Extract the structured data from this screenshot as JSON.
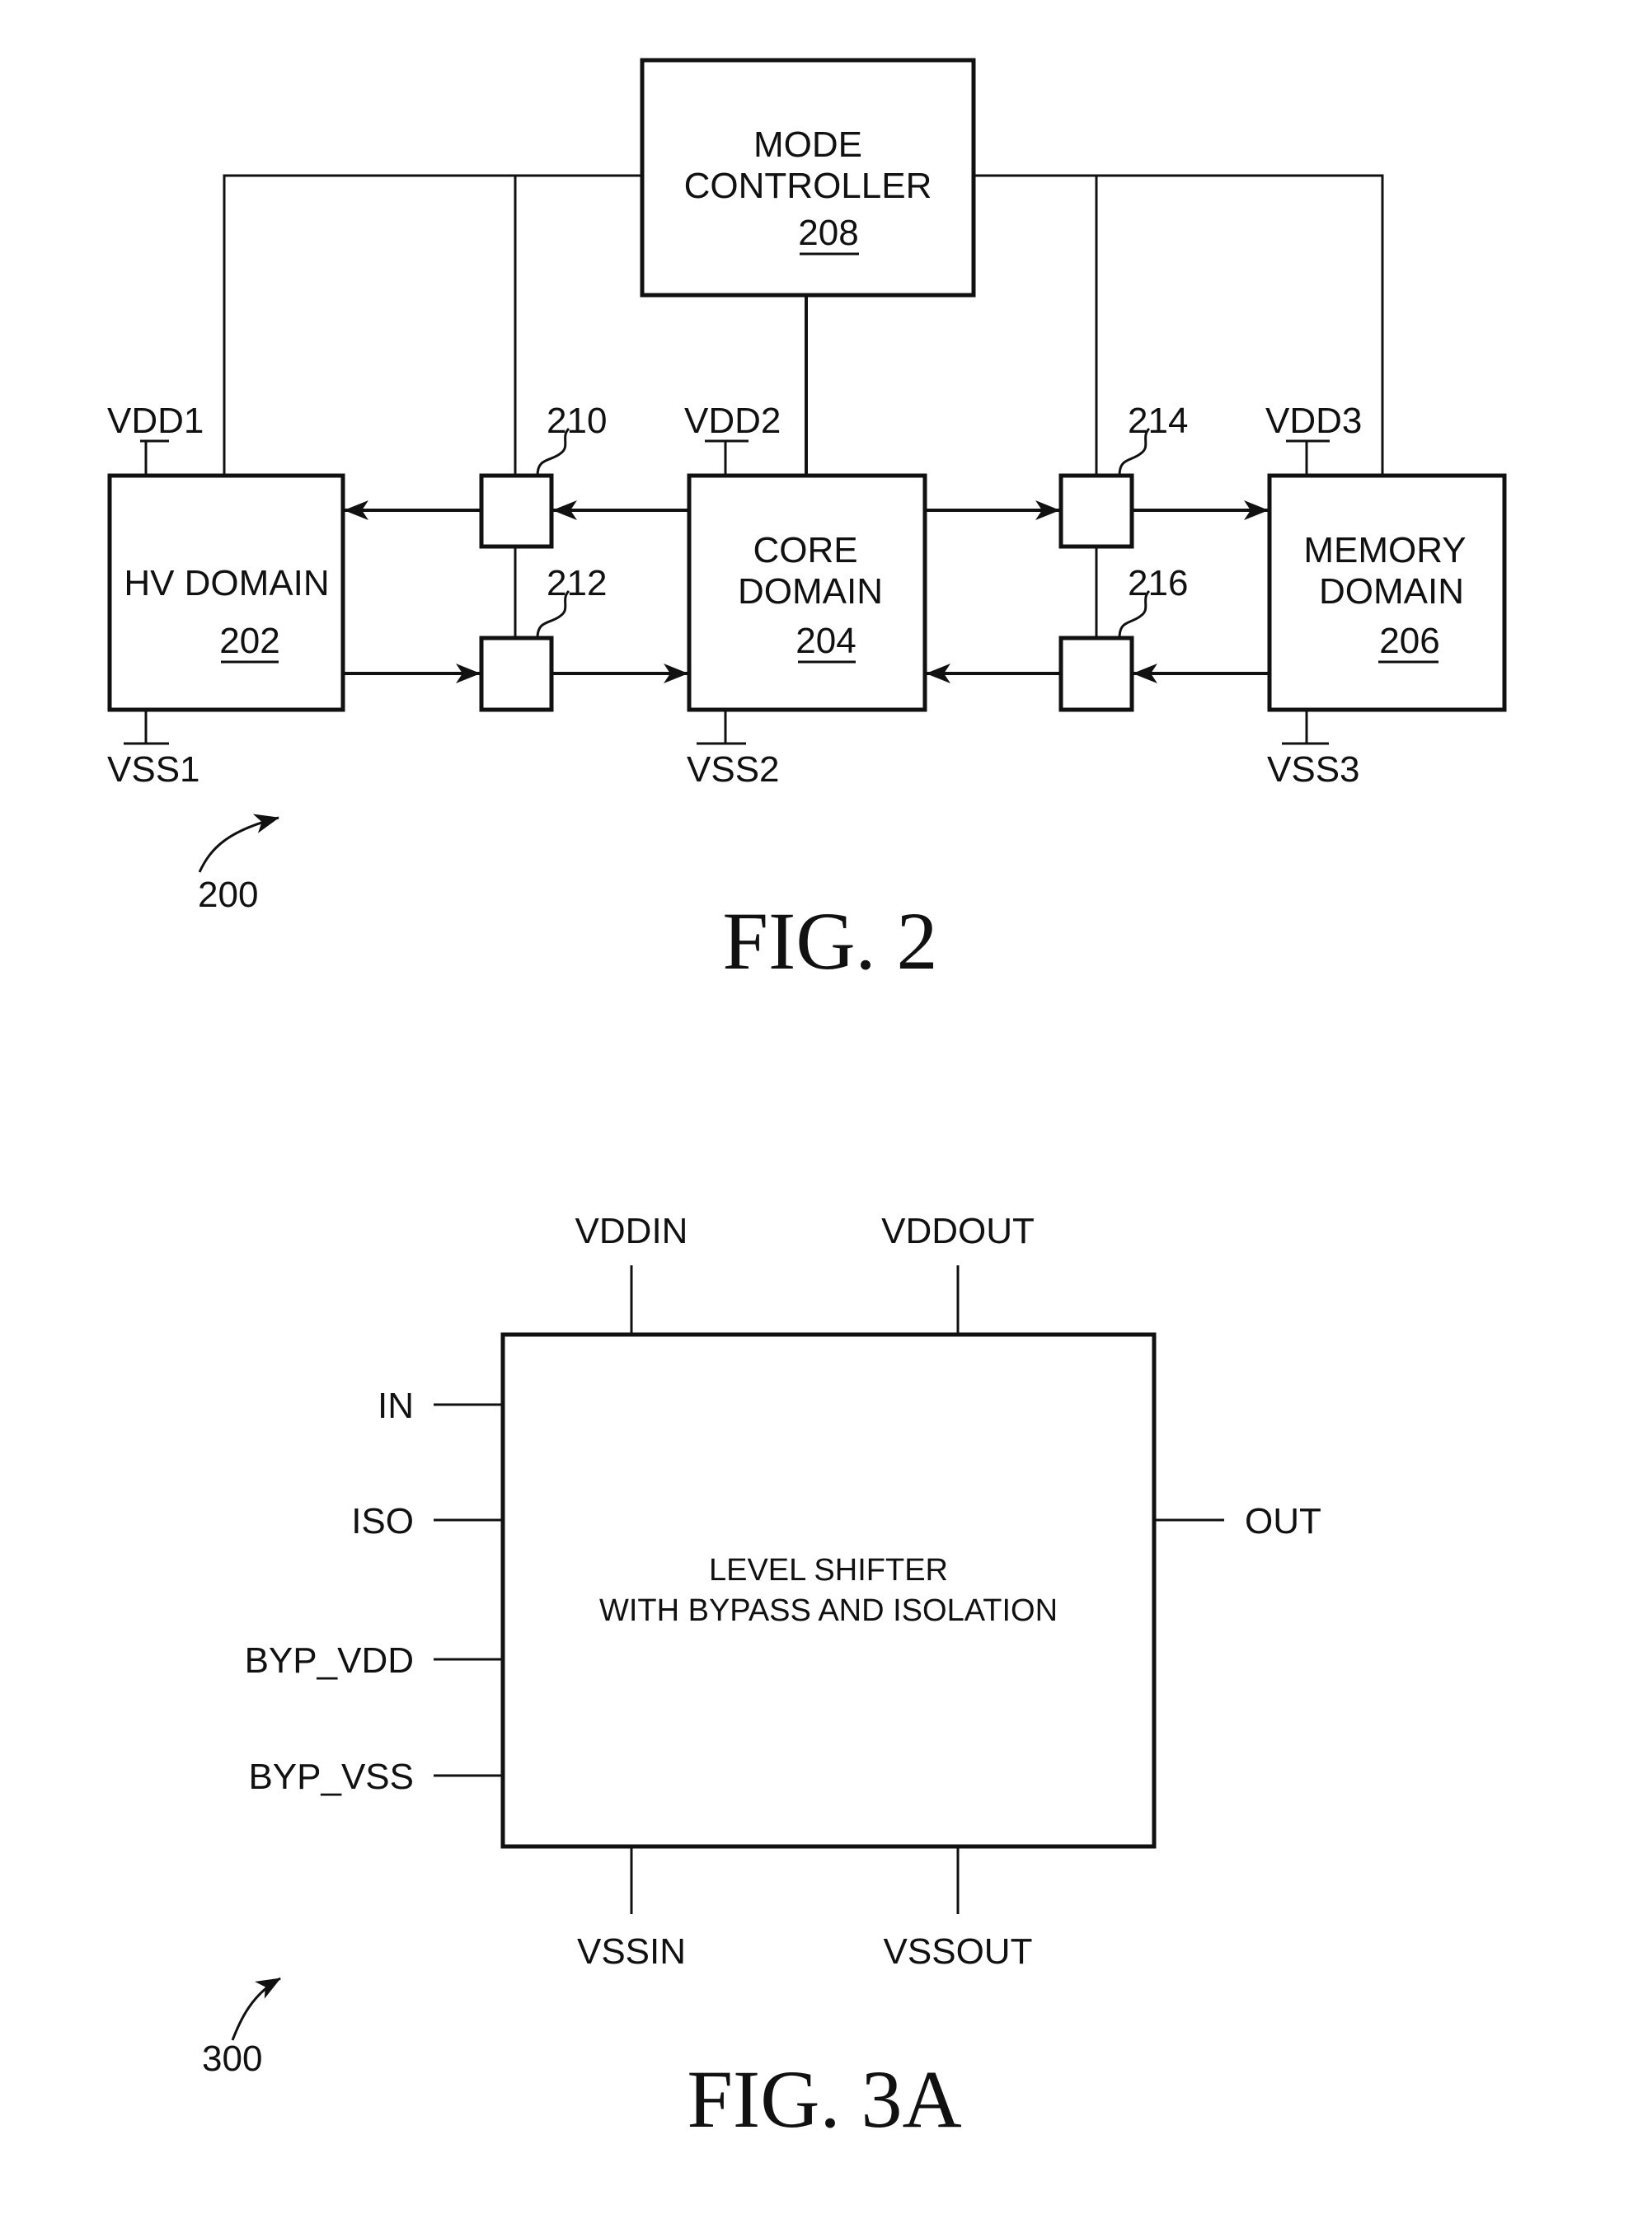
{
  "figure2": {
    "caption": "FIG. 2",
    "reference": "200",
    "mode_controller": {
      "line1": "MODE",
      "line2": "CONTROLLER",
      "ref": "208"
    },
    "hv_domain": {
      "line1": "HV DOMAIN",
      "ref": "202",
      "vdd": "VDD1",
      "vss": "VSS1"
    },
    "core_domain": {
      "line1": "CORE",
      "line2": "DOMAIN",
      "ref": "204",
      "vdd": "VDD2",
      "vss": "VSS2"
    },
    "memory_domain": {
      "line1": "MEMORY",
      "line2": "DOMAIN",
      "ref": "206",
      "vdd": "VDD3",
      "vss": "VSS3"
    },
    "shifters": {
      "s210": "210",
      "s212": "212",
      "s214": "214",
      "s216": "216"
    }
  },
  "figure3a": {
    "caption": "FIG. 3A",
    "reference": "300",
    "block": {
      "line1": "LEVEL SHIFTER",
      "line2": "WITH BYPASS AND ISOLATION"
    },
    "top_pins": {
      "vddin": "VDDIN",
      "vddout": "VDDOUT"
    },
    "bottom_pins": {
      "vssin": "VSSIN",
      "vssout": "VSSOUT"
    },
    "left_pins": {
      "in": "IN",
      "iso": "ISO",
      "byp_vdd": "BYP_VDD",
      "byp_vss": "BYP_VSS"
    },
    "right_pins": {
      "out": "OUT"
    }
  }
}
